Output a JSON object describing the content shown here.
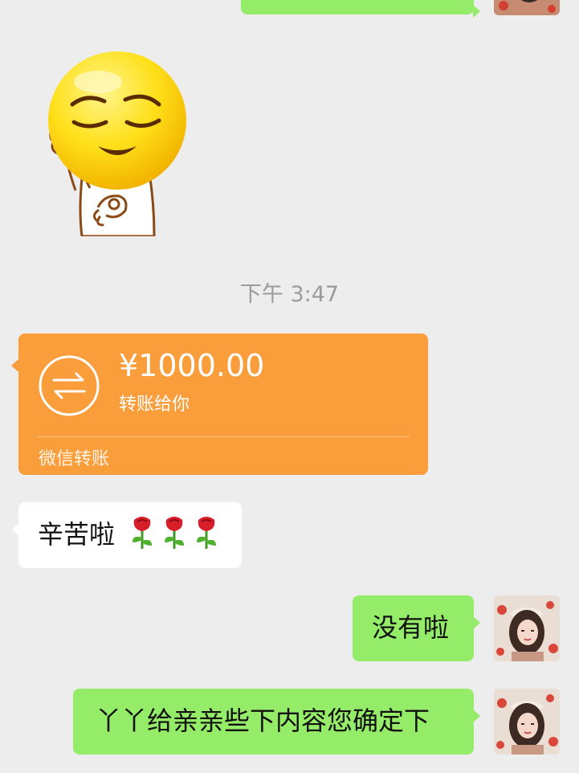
{
  "chat": {
    "timestamp": "下午 3:47",
    "transfer": {
      "amount": "¥1000.00",
      "caption": "转账给你",
      "footer": "微信转账",
      "accent_color": "#fa9d3b"
    },
    "messages": {
      "incoming_text": "辛苦啦",
      "incoming_emoji": "🌹🌹🌹",
      "outgoing_1": "没有啦",
      "outgoing_2": "丫丫给亲亲些下内容您确定下"
    },
    "colors": {
      "background": "#ededed",
      "outgoing_bubble": "#95ec69",
      "incoming_bubble": "#ffffff"
    },
    "icons": {
      "sticker": "ok-hand-smiley-sticker",
      "transfer": "transfer-arrows-icon"
    }
  }
}
